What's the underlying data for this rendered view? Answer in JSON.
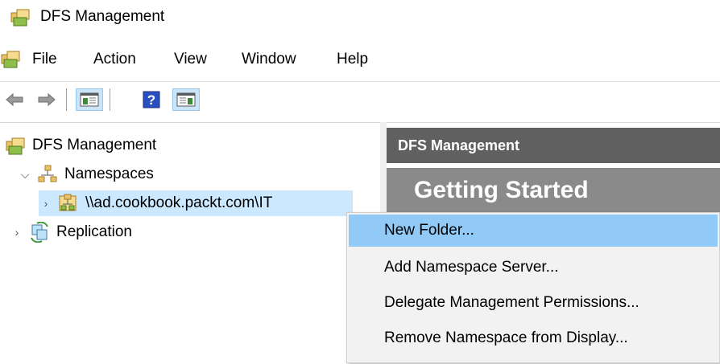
{
  "window": {
    "title": "DFS Management"
  },
  "menubar": {
    "items": [
      "File",
      "Action",
      "View",
      "Window",
      "Help"
    ]
  },
  "toolbar": {
    "buttons": [
      "back-icon",
      "forward-icon",
      "show-hide-console-tree-icon",
      "help-icon",
      "show-hide-action-pane-icon"
    ]
  },
  "tree": {
    "root_label": "DFS Management",
    "namespaces_label": "Namespaces",
    "namespace_item_label": "\\\\ad.cookbook.packt.com\\IT",
    "replication_label": "Replication"
  },
  "right_pane": {
    "header": "DFS Management",
    "section_title": "Getting Started"
  },
  "context_menu": {
    "items": [
      "New Folder...",
      "Add Namespace Server...",
      "Delegate Management Permissions...",
      "Remove Namespace from Display..."
    ],
    "highlighted": "New Folder..."
  },
  "colors": {
    "selection": "#cce8ff",
    "menu_highlight": "#91c9f7",
    "header_dark": "#606060",
    "header_gray": "#8a8a8a"
  }
}
